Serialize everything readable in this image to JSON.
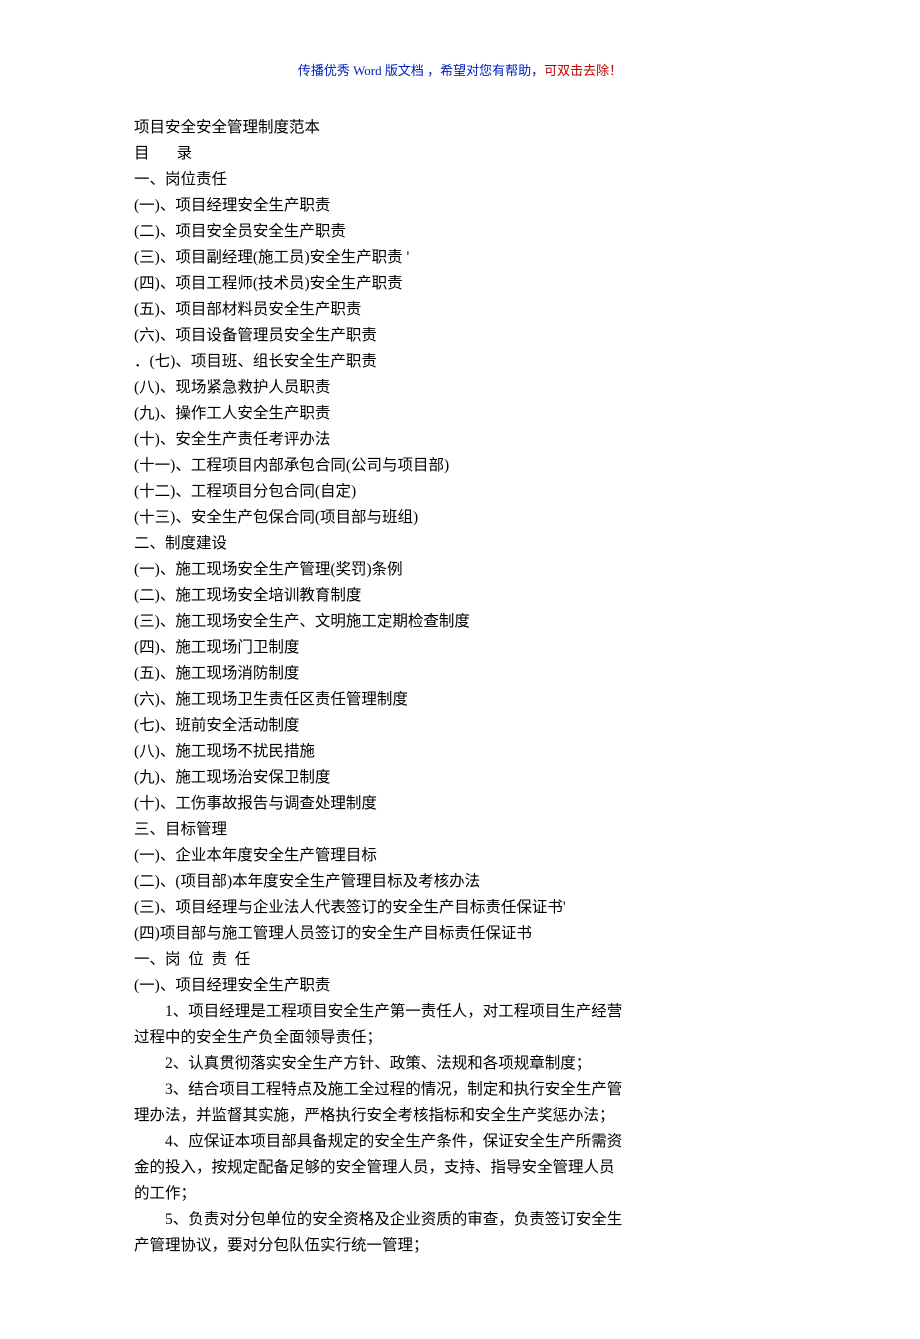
{
  "header": {
    "blue": "传播优秀 Word 版文档 ，希望对您有帮助，",
    "red": "可双击去除！"
  },
  "lines": [
    {
      "text": "项目安全安全管理制度范本",
      "indent": false
    },
    {
      "text": "目       录",
      "indent": false
    },
    {
      "text": "一、岗位责任",
      "indent": false
    },
    {
      "text": "(一)、项目经理安全生产职责",
      "indent": false
    },
    {
      "text": "(二)、项目安全员安全生产职责",
      "indent": false
    },
    {
      "text": "(三)、项目副经理(施工员)安全生产职责 '",
      "indent": false
    },
    {
      "text": "(四)、项目工程师(技术员)安全生产职责",
      "indent": false
    },
    {
      "text": "(五)、项目部材料员安全生产职责",
      "indent": false
    },
    {
      "text": "(六)、项目设备管理员安全生产职责",
      "indent": false
    },
    {
      "text": "．(七)、项目班、组长安全生产职责",
      "indent": false
    },
    {
      "text": "(八)、现场紧急救护人员职责",
      "indent": false
    },
    {
      "text": "(九)、操作工人安全生产职责",
      "indent": false
    },
    {
      "text": "(十)、安全生产责任考评办法",
      "indent": false
    },
    {
      "text": "(十一)、工程项目内部承包合同(公司与项目部)",
      "indent": false
    },
    {
      "text": "(十二)、工程项目分包合同(自定)",
      "indent": false
    },
    {
      "text": "(十三)、安全生产包保合同(项目部与班组)",
      "indent": false
    },
    {
      "text": "二、制度建设",
      "indent": false
    },
    {
      "text": "(一)、施工现场安全生产管理(奖罚)条例",
      "indent": false
    },
    {
      "text": "(二)、施工现场安全培训教育制度",
      "indent": false
    },
    {
      "text": "(三)、施工现场安全生产、文明施工定期检查制度",
      "indent": false
    },
    {
      "text": "(四)、施工现场门卫制度",
      "indent": false
    },
    {
      "text": "(五)、施工现场消防制度",
      "indent": false
    },
    {
      "text": "(六)、施工现场卫生责任区责任管理制度",
      "indent": false
    },
    {
      "text": "(七)、班前安全活动制度",
      "indent": false
    },
    {
      "text": "(八)、施工现场不扰民措施",
      "indent": false
    },
    {
      "text": "(九)、施工现场治安保卫制度",
      "indent": false
    },
    {
      "text": "(十)、工伤事故报告与调查处理制度",
      "indent": false
    },
    {
      "text": "三、目标管理",
      "indent": false
    },
    {
      "text": "(一)、企业本年度安全生产管理目标",
      "indent": false
    },
    {
      "text": "(二)、(项目部)本年度安全生产管理目标及考核办法",
      "indent": false
    },
    {
      "text": "(三)、项目经理与企业法人代表签订的安全生产目标责任保证书'",
      "indent": false
    },
    {
      "text": "(四)项目部与施工管理人员签订的安全生产目标责任保证书",
      "indent": false
    },
    {
      "text": "一、岗  位  责  任",
      "indent": false
    },
    {
      "text": "(一)、项目经理安全生产职责",
      "indent": false
    },
    {
      "text": "1、项目经理是工程项目安全生产第一责任人，对工程项目生产经营",
      "indent": true
    },
    {
      "text": "过程中的安全生产负全面领导责任；",
      "indent": false
    },
    {
      "text": "2、认真贯彻落实安全生产方针、政策、法规和各项规章制度；",
      "indent": true
    },
    {
      "text": "3、结合项目工程特点及施工全过程的情况，制定和执行安全生产管",
      "indent": true
    },
    {
      "text": "理办法，并监督其实施，严格执行安全考核指标和安全生产奖惩办法；",
      "indent": false
    },
    {
      "text": "4、应保证本项目部具备规定的安全生产条件，保证安全生产所需资",
      "indent": true
    },
    {
      "text": "金的投入，按规定配备足够的安全管理人员，支持、指导安全管理人员",
      "indent": false
    },
    {
      "text": "的工作；",
      "indent": false
    },
    {
      "text": "5、负责对分包单位的安全资格及企业资质的审查，负责签订安全生",
      "indent": true
    },
    {
      "text": "产管理协议，要对分包队伍实行统一管理；",
      "indent": false
    }
  ]
}
